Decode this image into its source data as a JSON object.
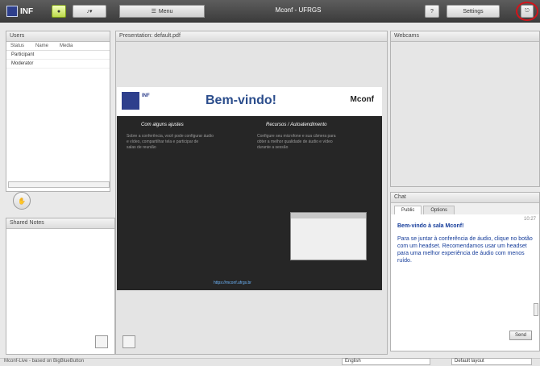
{
  "topbar": {
    "logo": "INF",
    "menu_label": "Menu",
    "room_title": "Mconf - UFRGS",
    "settings_label": "Settings",
    "colors": {
      "accent": "#bcd94a",
      "logout_highlight": "#d2141b"
    }
  },
  "users": {
    "title": "Users",
    "col_status": "Status",
    "col_name": "Name",
    "col_media": "Media",
    "rows": [
      "Participant",
      "Moderator"
    ]
  },
  "notes": {
    "title": "Shared Notes"
  },
  "presentation": {
    "title": "Presentation: default.pdf",
    "slide": {
      "header": "Bem-vindo!",
      "brand": "Mconf",
      "left_title": "Com alguns ajustes",
      "right_title": "Recursos / Autoatendimento",
      "left_text": [
        "Sobre a conferência, você pode configurar áudio",
        "e vídeo, compartilhar tela e participar de",
        "salas de reunião"
      ],
      "right_text": [
        "Configure seu microfone e sua câmera para",
        "obter a melhor qualidade de áudio e vídeo",
        "durante a sessão"
      ],
      "link": "https://mconf.ufrgs.br"
    }
  },
  "video": {
    "title": "Webcams"
  },
  "chat": {
    "title": "Chat",
    "tabs": [
      "Public",
      "Options"
    ],
    "time": "10:27",
    "welcome_title": "Bem-vindo à sala Mconf!",
    "message": "Para se juntar à conferência de áudio, clique no botão com um headset. Recomendamos usar um headset para uma melhor experiência de áudio com menos ruído.",
    "send_label": "Send"
  },
  "status": {
    "text": "Mconf-Live - based on BigBlueButton",
    "language": "English",
    "layout": "Default layout"
  }
}
